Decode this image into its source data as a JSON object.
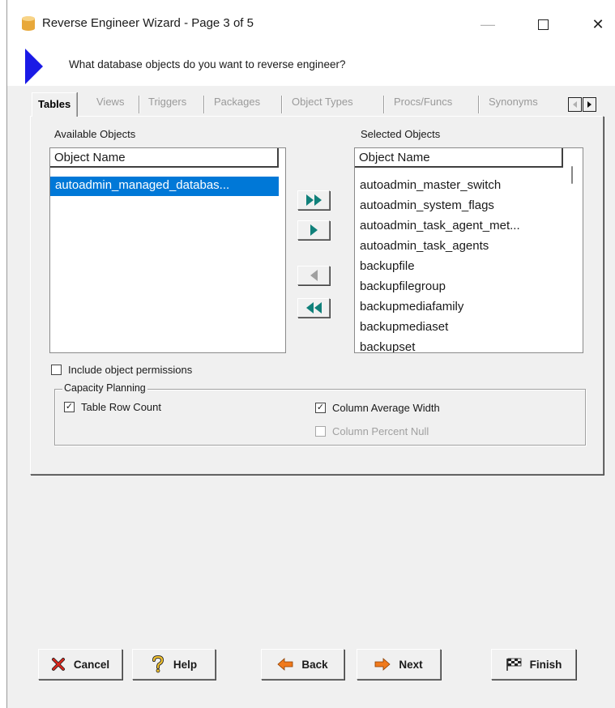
{
  "window": {
    "title": "Reverse Engineer Wizard - Page 3 of 5",
    "controls": {
      "minimize": "—",
      "close": "✕"
    }
  },
  "header": {
    "question": "What database objects do you want to reverse engineer?"
  },
  "tabs": [
    {
      "label": "Tables",
      "active": true
    },
    {
      "label": "Views"
    },
    {
      "label": "Triggers"
    },
    {
      "label": "Packages"
    },
    {
      "label": "Object Types"
    },
    {
      "label": "Procs/Funcs"
    },
    {
      "label": "Synonyms"
    }
  ],
  "available": {
    "label": "Available Objects",
    "column_header": "Object Name",
    "items": [
      "autoadmin_managed_databas..."
    ],
    "selected_index": 0
  },
  "selected": {
    "label": "Selected Objects",
    "column_header": "Object Name",
    "items": [
      "autoadmin_master_switch",
      "autoadmin_system_flags",
      "autoadmin_task_agent_met...",
      "autoadmin_task_agents",
      "backupfile",
      "backupfilegroup",
      "backupmediafamily",
      "backupmediaset",
      "backupset"
    ]
  },
  "options": {
    "include_permissions": {
      "label": "Include object permissions",
      "checked": false
    },
    "capacity": {
      "legend": "Capacity Planning",
      "table_row_count": {
        "label": "Table Row Count",
        "checked": true
      },
      "column_avg_width": {
        "label": "Column Average Width",
        "checked": true
      },
      "column_percent_null": {
        "label": "Column Percent Null",
        "checked": false,
        "disabled": true
      }
    }
  },
  "buttons": {
    "cancel": "Cancel",
    "help": "Help",
    "back": "Back",
    "next": "Next",
    "finish": "Finish"
  },
  "colors": {
    "accent_blue": "#1a1ae6",
    "selection": "#0078d7",
    "move_arrow": "#10807a"
  }
}
